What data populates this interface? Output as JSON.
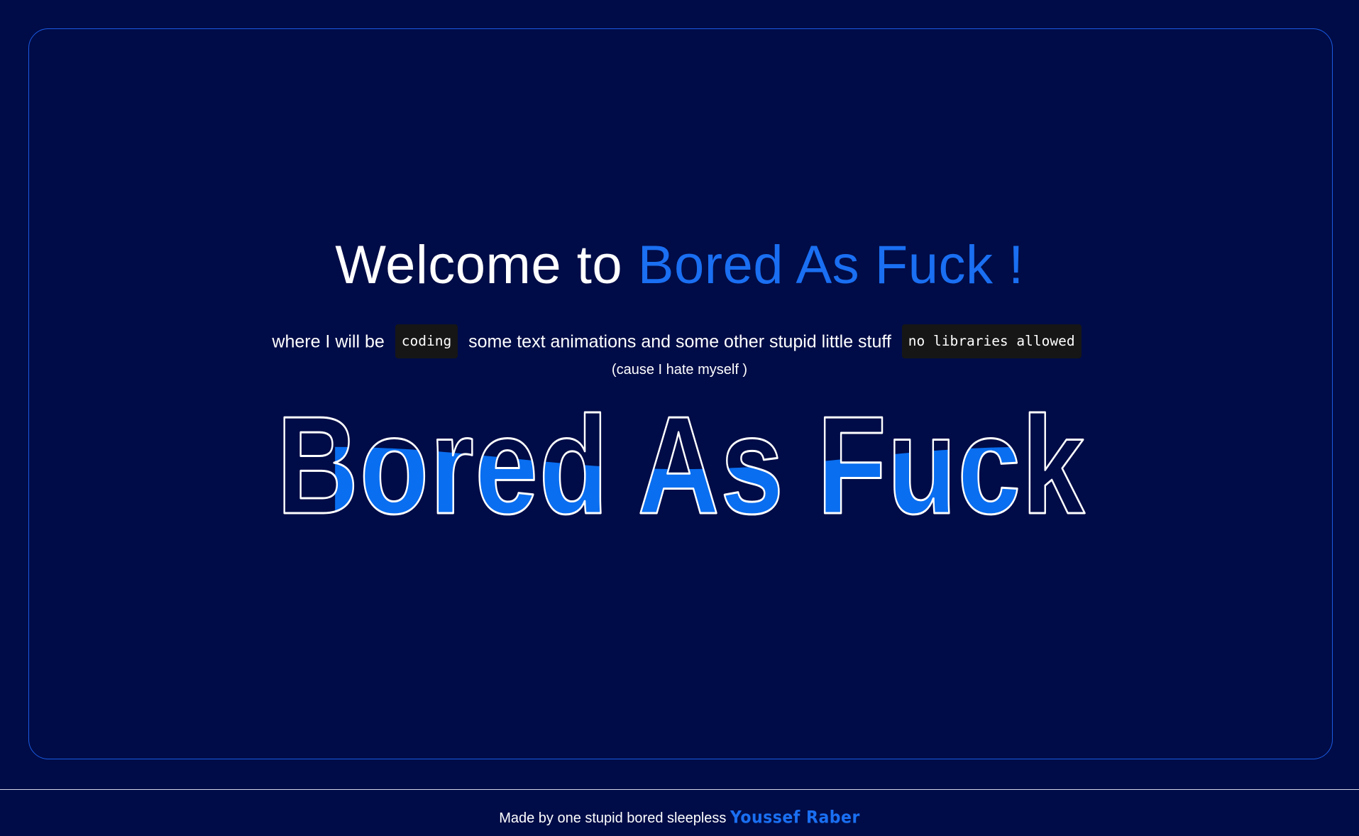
{
  "welcome": {
    "prefix": "Welcome to",
    "brand": "Bored As Fuck !"
  },
  "subtitle": {
    "text_before": "where I will be",
    "chip_coding": "coding",
    "text_middle": "some text animations and some other stupid little stuff",
    "chip_no_libraries": "no libraries allowed"
  },
  "aside": "(cause I hate myself )",
  "wave_title": {
    "text": "Bored As Fuck",
    "fill_color": "#0a6ef0",
    "outline_color": "#ffffff",
    "fill_level": 0.55
  },
  "footer": {
    "prefix": "Made by one stupid bored sleepless",
    "author": "Youssef Raber"
  },
  "colors": {
    "background": "#000c47",
    "accent": "#1a6ff2",
    "frame_border": "#1b5be3",
    "chip_background": "#161616"
  }
}
